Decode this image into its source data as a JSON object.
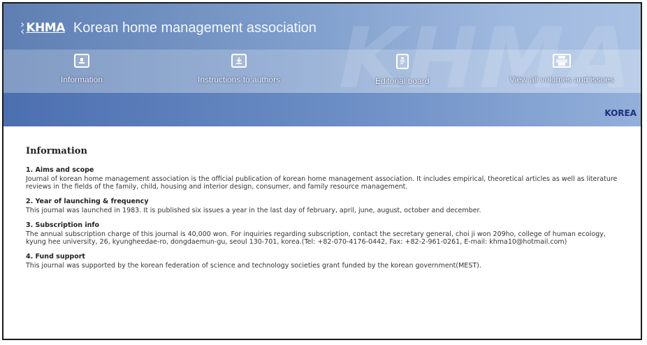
{
  "header": {
    "logo_text": "KHMA",
    "site_title": "Korean home management association",
    "watermark": "KHMA",
    "country": "KOREA"
  },
  "nav": {
    "items": [
      {
        "label": "Information",
        "icon": "info-icon"
      },
      {
        "label": "Instructions to authors",
        "icon": "download-icon"
      },
      {
        "label": "Editorial board",
        "icon": "clipboard-icon"
      },
      {
        "label": "View all volumes and issues",
        "icon": "printer-icon"
      }
    ]
  },
  "main": {
    "heading": "Information",
    "sections": [
      {
        "title": "1. Aims and scope",
        "body": "Journal of korean home management association is the official publication of korean home management association. It includes empirical, theoretical articles as well as literature reviews in the fields of the family, child, housing and interior design, consumer, and family resource management."
      },
      {
        "title": "2. Year of launching & frequency",
        "body": "This journal was launched in 1983. It is published six issues a year in the last day of february, april, june, august, october and december."
      },
      {
        "title": "3. Subscription info",
        "body": "The annual subscription charge of this journal is 40,000 won. For inquiries regarding subscription, contact the secretary general, choi ji won 209ho, college of human ecology, kyung hee university, 26, kyungheedae-ro, dongdaemun-gu, seoul 130-701, korea.(Tel: +82-070-4176-0442, Fax: +82-2-961-0261, E-mail: khma10@hotmail.com)"
      },
      {
        "title": "4. Fund support",
        "body": "This journal was supported by the korean federation of science and technology societies grant funded by the korean government(MEST)."
      }
    ]
  },
  "colors": {
    "header_blue": "#6d8fc6",
    "banner_blue": "#4c6fb0",
    "country_text": "#1c2e7a"
  }
}
